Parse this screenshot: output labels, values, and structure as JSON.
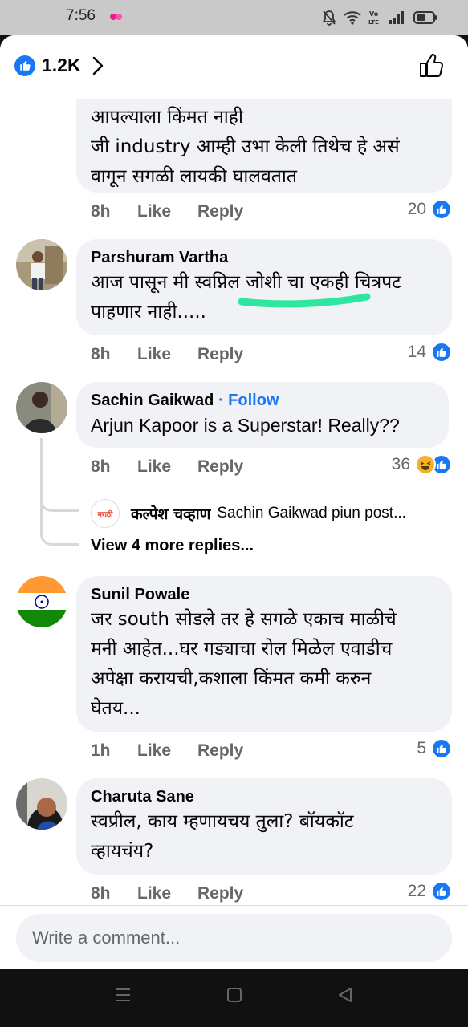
{
  "status_bar": {
    "time": "7:56",
    "lte_label": "Vo\nLTE"
  },
  "header": {
    "reaction_count": "1.2K"
  },
  "comments": [
    {
      "lines": [
        "आपल्याला किंमत नाही",
        "जी industry आम्ही उभा केली तिथेच हे असं",
        "वागून सगळी लायकी घालवतात"
      ],
      "time": "8h",
      "like": "Like",
      "reply": "Reply",
      "reactions": "20"
    },
    {
      "name": "Parshuram Vartha",
      "lines": [
        "आज पासून मी स्वप्निल जोशी चा एकही चित्रपट",
        "पाहणार नाही....."
      ],
      "time": "8h",
      "like": "Like",
      "reply": "Reply",
      "reactions": "14"
    },
    {
      "name": "Sachin Gaikwad",
      "follow": "· Follow",
      "lines": [
        "Arjun Kapoor is a Superstar! Really??"
      ],
      "time": "8h",
      "like": "Like",
      "reply": "Reply",
      "reactions": "36"
    },
    {
      "name": "Sunil Powale",
      "lines": [
        "जर south सोडले तर हे सगळे एकाच माळीचे",
        "मनी आहेत...घर गड्याचा रोल मिळेल एवाडीच",
        "अपेक्षा करायची,कशाला किंमत कमी करुन",
        "घेतय..."
      ],
      "time": "1h",
      "like": "Like",
      "reply": "Reply",
      "reactions": "5"
    },
    {
      "name": "Charuta Sane",
      "lines": [
        "स्वप्रील, काय म्हणायचय तुला? बॉयकॉट",
        "व्हायचंय?"
      ],
      "time": "8h",
      "like": "Like",
      "reply": "Reply",
      "reactions": "22"
    }
  ],
  "reply_preview": {
    "name": "कल्पेश चव्हाण",
    "text": "Sachin Gaikwad piun post...",
    "avatar_label": "मराठी"
  },
  "more_replies": "View 4 more replies...",
  "composer": {
    "placeholder": "Write a comment..."
  },
  "colors": {
    "facebook_blue": "#1877f2",
    "bubble": "#f0f2f5",
    "secondary_text": "#65676b",
    "highlight_mark": "#2ee6a0"
  }
}
